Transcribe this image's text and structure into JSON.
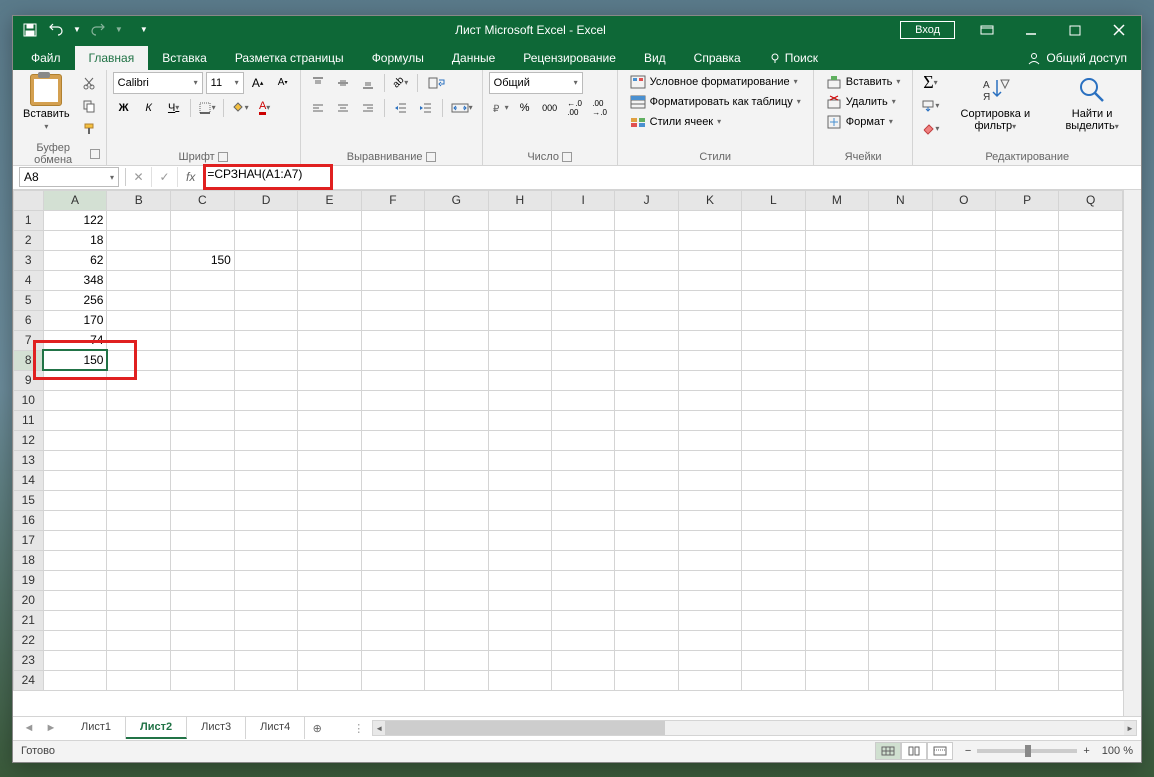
{
  "titlebar": {
    "title": "Лист Microsoft Excel  -  Excel",
    "login": "Вход"
  },
  "tabs": {
    "file": "Файл",
    "home": "Главная",
    "insert": "Вставка",
    "layout": "Разметка страницы",
    "formulas": "Формулы",
    "data": "Данные",
    "review": "Рецензирование",
    "view": "Вид",
    "help": "Справка",
    "search": "Поиск",
    "share": "Общий доступ"
  },
  "ribbon": {
    "clipboard": {
      "paste": "Вставить",
      "label": "Буфер обмена"
    },
    "font": {
      "name": "Calibri",
      "size": "11",
      "label": "Шрифт"
    },
    "alignment": {
      "label": "Выравнивание"
    },
    "number": {
      "format": "Общий",
      "label": "Число"
    },
    "styles": {
      "conditional": "Условное форматирование",
      "table": "Форматировать как таблицу",
      "cell": "Стили ячеек",
      "label": "Стили"
    },
    "cells": {
      "insert": "Вставить",
      "delete": "Удалить",
      "format": "Формат",
      "label": "Ячейки"
    },
    "editing": {
      "sort": "Сортировка и фильтр",
      "find": "Найти и выделить",
      "label": "Редактирование"
    }
  },
  "formulaBar": {
    "nameBox": "A8",
    "formula": "=СРЗНАЧ(A1:A7)"
  },
  "columns": [
    "A",
    "B",
    "C",
    "D",
    "E",
    "F",
    "G",
    "H",
    "I",
    "J",
    "K",
    "L",
    "M",
    "N",
    "O",
    "P",
    "Q"
  ],
  "rows": [
    1,
    2,
    3,
    4,
    5,
    6,
    7,
    8,
    9,
    10,
    11,
    12,
    13,
    14,
    15,
    16,
    17,
    18,
    19,
    20,
    21,
    22,
    23,
    24
  ],
  "selectedCell": {
    "row": 8,
    "col": "A"
  },
  "cells": {
    "A1": "122",
    "A2": "18",
    "A3": "62",
    "C3": "150",
    "A4": "348",
    "A5": "256",
    "A6": "170",
    "A7": "74",
    "A8": "150"
  },
  "sheets": {
    "items": [
      "Лист1",
      "Лист2",
      "Лист3",
      "Лист4"
    ],
    "active": "Лист2"
  },
  "statusBar": {
    "status": "Готово",
    "zoom": "100 %"
  }
}
